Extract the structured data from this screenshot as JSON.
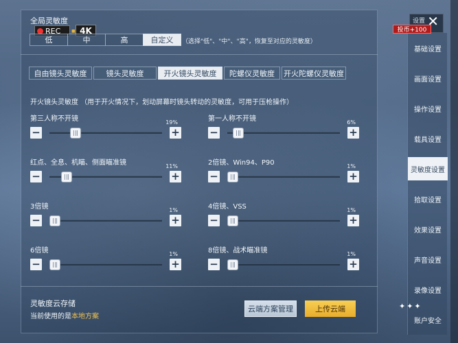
{
  "top": {
    "global_label": "全局灵敏度",
    "rec_text": "REC",
    "k4_text": "4K",
    "k4_small": "■",
    "modes": [
      "低",
      "中",
      "高",
      "自定义"
    ],
    "active_mode": 3,
    "hint": "（选择\"低\"、\"中\"、\"高\"，恢复至对应的灵敏度）"
  },
  "tabs": [
    {
      "label": "自由镜头灵敏度",
      "width": 92
    },
    {
      "label": "镜头灵敏度",
      "width": 92
    },
    {
      "label": "开火镜头灵敏度",
      "width": 94
    },
    {
      "label": "陀螺仪灵敏度",
      "width": 82
    },
    {
      "label": "开火陀螺仪灵敏度",
      "width": 94
    }
  ],
  "active_tab": 2,
  "section_title": "开火镜头灵敏度 （用于开火情况下，划动屏幕时镜头转动的灵敏度，可用于压枪操作）",
  "sliders": [
    {
      "label": "第三人称不开镜",
      "value_text": "19%",
      "value": 19
    },
    {
      "label": "第一人称不开镜",
      "value_text": "6%",
      "value": 6
    },
    {
      "label": "红点、全息、机瞄、侧面瞄准镜",
      "value_text": "11%",
      "value": 11
    },
    {
      "label": "2倍镜、Win94、P90",
      "value_text": "1%",
      "value": 1
    },
    {
      "label": "3倍镜",
      "value_text": "1%",
      "value": 1
    },
    {
      "label": "4倍镜、VSS",
      "value_text": "1%",
      "value": 1
    },
    {
      "label": "6倍镜",
      "value_text": "1%",
      "value": 1
    },
    {
      "label": "8倍镜、战术瞄准镜",
      "value_text": "1%",
      "value": 1
    }
  ],
  "minus_symbol": "−",
  "plus_symbol": "+",
  "bottom": {
    "cloud_title": "灵敏度云存储",
    "current_prefix": "当前使用的是",
    "current_value": "本地方案",
    "manage_label": "云端方案管理",
    "upload_label": "上传云端"
  },
  "close": {
    "small_text": "设置",
    "x": "✕"
  },
  "coin_badge": "投币+100",
  "stars": "✦✦✦",
  "sidebar": [
    "基础设置",
    "画面设置",
    "操作设置",
    "载具设置",
    "灵敏度设置",
    "拾取设置",
    "效果设置",
    "声音设置",
    "录像设置",
    "账户安全"
  ],
  "active_sidebar": 4
}
